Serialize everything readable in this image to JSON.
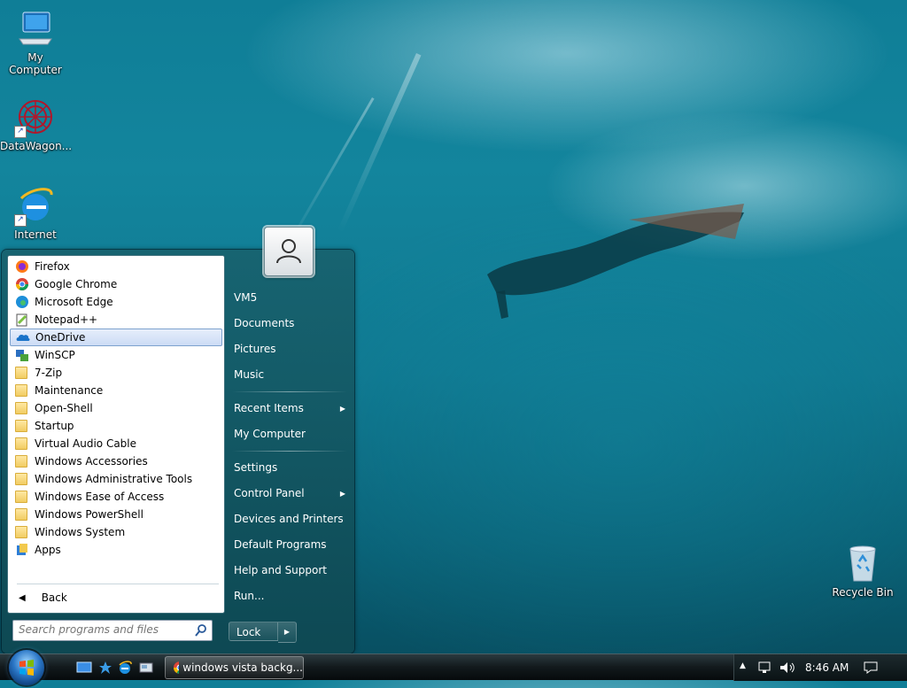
{
  "desktop": {
    "icons": [
      {
        "label": "My Computer"
      },
      {
        "label": "DataWagon..."
      },
      {
        "label": "Internet"
      },
      {
        "label": "Recycle Bin"
      }
    ]
  },
  "start_menu": {
    "programs": [
      {
        "label": "Firefox",
        "icon": "firefox-icon"
      },
      {
        "label": "Google Chrome",
        "icon": "chrome-icon"
      },
      {
        "label": "Microsoft Edge",
        "icon": "edge-icon"
      },
      {
        "label": "Notepad++",
        "icon": "notepadpp-icon"
      },
      {
        "label": "OneDrive",
        "icon": "onedrive-icon",
        "selected": true
      },
      {
        "label": "WinSCP",
        "icon": "winscp-icon"
      },
      {
        "label": "7-Zip",
        "icon": "folder-icon"
      },
      {
        "label": "Maintenance",
        "icon": "folder-icon"
      },
      {
        "label": "Open-Shell",
        "icon": "folder-icon"
      },
      {
        "label": "Startup",
        "icon": "folder-icon"
      },
      {
        "label": "Virtual Audio Cable",
        "icon": "folder-icon"
      },
      {
        "label": "Windows Accessories",
        "icon": "folder-icon"
      },
      {
        "label": "Windows Administrative Tools",
        "icon": "folder-icon"
      },
      {
        "label": "Windows Ease of Access",
        "icon": "folder-icon"
      },
      {
        "label": "Windows PowerShell",
        "icon": "folder-icon"
      },
      {
        "label": "Windows System",
        "icon": "folder-icon"
      },
      {
        "label": "Apps",
        "icon": "apps-icon"
      }
    ],
    "back_label": "Back",
    "search_placeholder": "Search programs and files",
    "right": {
      "user": "VM5",
      "documents": "Documents",
      "pictures": "Pictures",
      "music": "Music",
      "recent_items": "Recent Items",
      "my_computer": "My Computer",
      "settings": "Settings",
      "control_panel": "Control Panel",
      "devices_printers": "Devices and Printers",
      "default_programs": "Default Programs",
      "help_support": "Help and Support",
      "run": "Run..."
    },
    "lock_label": "Lock"
  },
  "taskbar": {
    "window_button": "windows vista backg...",
    "clock": "8:46 AM"
  }
}
